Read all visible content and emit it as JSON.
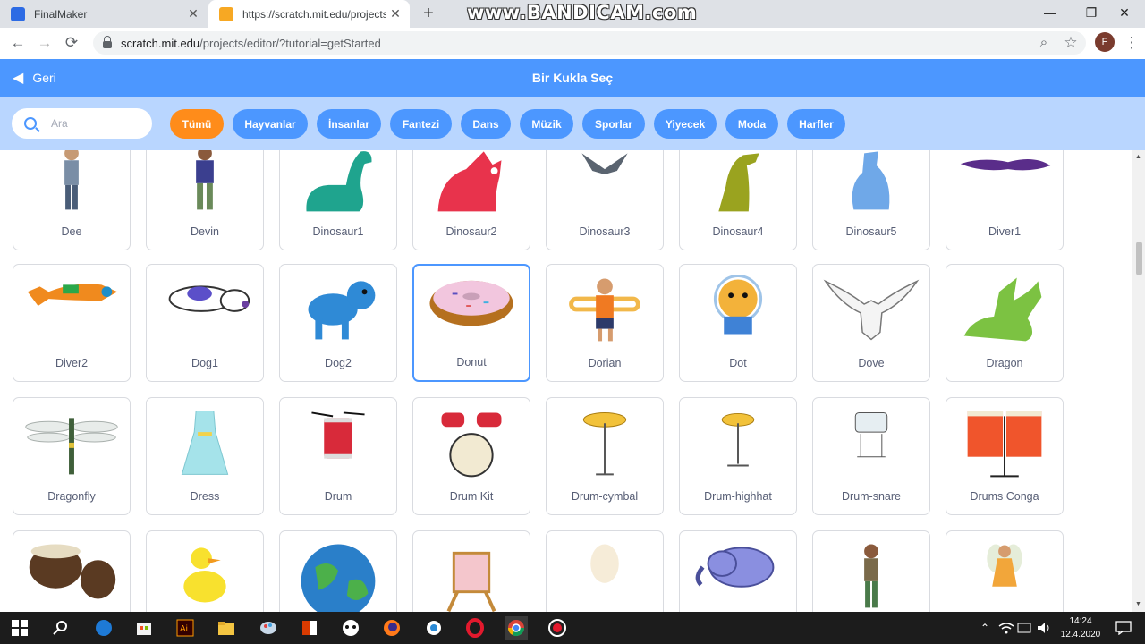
{
  "browser": {
    "tabs": [
      {
        "title": "FinalMaker",
        "favicon_color": "#2d6be4"
      },
      {
        "title": "https://scratch.mit.edu/projects/e",
        "favicon_color": "#f7a823"
      }
    ],
    "close_glyph": "✕",
    "new_tab_glyph": "+",
    "watermark": "www.BANDICAM.com",
    "window_controls": [
      "—",
      "❐",
      "✕"
    ],
    "url_host": "scratch.mit.edu",
    "url_path": "/projects/editor/?tutorial=getStarted",
    "profile_initial": "F",
    "nav": {
      "back": "←",
      "forward": "→",
      "reload": "⟳"
    },
    "zoom_glyph": "⌕",
    "star_glyph": "☆",
    "menu_glyph": "⋮"
  },
  "header": {
    "back_label": "Geri",
    "title": "Bir Kukla Seç",
    "color": "#4c97ff"
  },
  "filters": {
    "search_placeholder": "Ara",
    "categories": [
      "Tümü",
      "Hayvanlar",
      "İnsanlar",
      "Fantezi",
      "Dans",
      "Müzik",
      "Sporlar",
      "Yiyecek",
      "Moda",
      "Harfler"
    ],
    "selected": "Tümü",
    "selected_color": "#ff8c1a"
  },
  "sprites": {
    "row1": [
      "Dee",
      "Devin",
      "Dinosaur1",
      "Dinosaur2",
      "Dinosaur3",
      "Dinosaur4",
      "Dinosaur5",
      "Diver1"
    ],
    "row2": [
      "Diver2",
      "Dog1",
      "Dog2",
      "Donut",
      "Dorian",
      "Dot",
      "Dove",
      "Dragon"
    ],
    "row3": [
      "Dragonfly",
      "Dress",
      "Drum",
      "Drum Kit",
      "Drum-cymbal",
      "Drum-highhat",
      "Drum-snare",
      "Drums Conga"
    ],
    "selected": "Donut"
  },
  "taskbar": {
    "time": "14:24",
    "date": "12.4.2020",
    "app_icons": [
      "windows-icon",
      "search-icon",
      "edge-icon",
      "store-icon",
      "illustrator-icon",
      "explorer-icon",
      "paint-icon",
      "office-icon",
      "panda-icon",
      "firefox-icon",
      "app-icon",
      "opera-icon",
      "chrome-icon",
      "record-icon"
    ]
  }
}
